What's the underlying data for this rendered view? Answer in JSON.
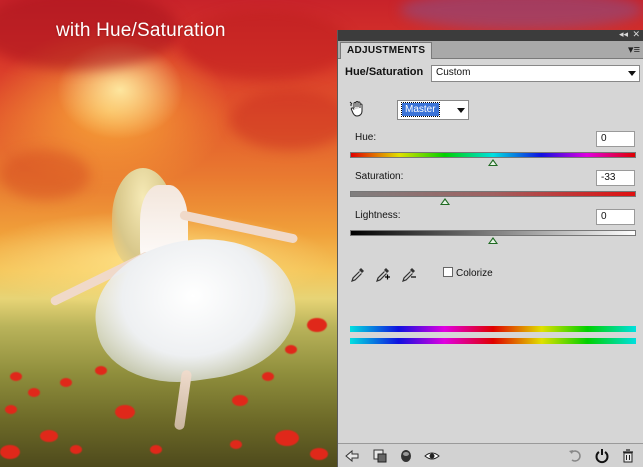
{
  "image": {
    "caption": "with Hue/Saturation"
  },
  "panel": {
    "tab_label": "ADJUSTMENTS",
    "menu_glyph": "▾≡",
    "collapse_glyph": "◂◂",
    "close_glyph": "✕",
    "adjustment_title": "Hue/Saturation",
    "preset": {
      "selected": "Custom"
    },
    "channel": {
      "selected": "Master"
    },
    "hue": {
      "label": "Hue:",
      "value": "0"
    },
    "saturation": {
      "label": "Saturation:",
      "value": "-33"
    },
    "lightness": {
      "label": "Lightness:",
      "value": "0"
    },
    "colorize": {
      "label": "Colorize",
      "checked": false
    },
    "icons": {
      "hand": "targeted-adjustment-hand-icon",
      "eyedroppers": [
        "eyedropper-icon",
        "eyedropper-plus-icon",
        "eyedropper-minus-icon"
      ],
      "bottom": [
        "return-to-list-icon",
        "clip-to-layer-icon",
        "layer-visibility-toggle-icon",
        "view-previous-state-icon",
        "reset-icon",
        "delete-icon"
      ]
    }
  }
}
